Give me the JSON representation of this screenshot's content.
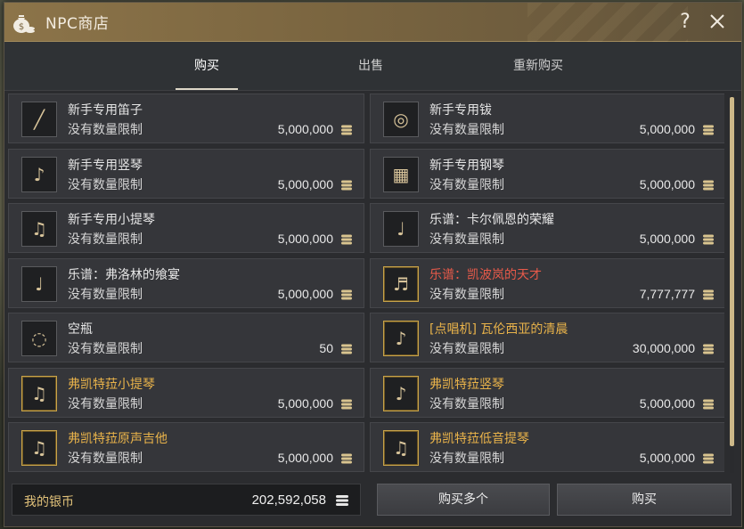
{
  "window": {
    "title": "NPC商店"
  },
  "tabs": [
    {
      "label": "购买",
      "active": true
    },
    {
      "label": "出售",
      "active": false
    },
    {
      "label": "重新购买",
      "active": false
    }
  ],
  "items": [
    {
      "name": "新手专用笛子",
      "limit": "没有数量限制",
      "price": "5,000,000",
      "icon": "flute-icon",
      "name_color": "white"
    },
    {
      "name": "新手专用钹",
      "limit": "没有数量限制",
      "price": "5,000,000",
      "icon": "cymbal-icon",
      "name_color": "white"
    },
    {
      "name": "新手专用竖琴",
      "limit": "没有数量限制",
      "price": "5,000,000",
      "icon": "harp-icon",
      "name_color": "white"
    },
    {
      "name": "新手专用钢琴",
      "limit": "没有数量限制",
      "price": "5,000,000",
      "icon": "piano-icon",
      "name_color": "white"
    },
    {
      "name": "新手专用小提琴",
      "limit": "没有数量限制",
      "price": "5,000,000",
      "icon": "violin-icon",
      "name_color": "white"
    },
    {
      "name": "乐谱：卡尔佩恩的荣耀",
      "limit": "没有数量限制",
      "price": "5,000,000",
      "icon": "sheet-music-icon",
      "name_color": "white"
    },
    {
      "name": "乐谱：弗洛林的飨宴",
      "limit": "没有数量限制",
      "price": "5,000,000",
      "icon": "sheet-music-icon",
      "name_color": "white"
    },
    {
      "name": "乐谱：凯波岚的天才",
      "limit": "没有数量限制",
      "price": "7,777,777",
      "icon": "golden-sheet-icon",
      "name_color": "red"
    },
    {
      "name": "空瓶",
      "limit": "没有数量限制",
      "price": "50",
      "icon": "bottle-icon",
      "name_color": "white"
    },
    {
      "name": "[点唱机] 瓦伦西亚的清晨",
      "limit": "没有数量限制",
      "price": "30,000,000",
      "icon": "jukebox-icon",
      "name_color": "orange"
    },
    {
      "name": "弗凯特菈小提琴",
      "limit": "没有数量限制",
      "price": "5,000,000",
      "icon": "violin-icon",
      "name_color": "orange"
    },
    {
      "name": "弗凯特菈竖琴",
      "limit": "没有数量限制",
      "price": "5,000,000",
      "icon": "harp-icon",
      "name_color": "orange"
    },
    {
      "name": "弗凯特菈原声吉他",
      "limit": "没有数量限制",
      "price": "5,000,000",
      "icon": "guitar-icon",
      "name_color": "orange"
    },
    {
      "name": "弗凯特菈低音提琴",
      "limit": "没有数量限制",
      "price": "5,000,000",
      "icon": "contrabass-icon",
      "name_color": "orange"
    }
  ],
  "footer": {
    "silver_label": "我的银币",
    "silver_value": "202,592,058",
    "buy_multiple_label": "购买多个",
    "buy_label": "购买"
  },
  "colors": {
    "title_bar": "#8c7449",
    "accent_gold": "#e2c27a",
    "name_orange": "#e9b34a",
    "name_red": "#e85a4a"
  }
}
